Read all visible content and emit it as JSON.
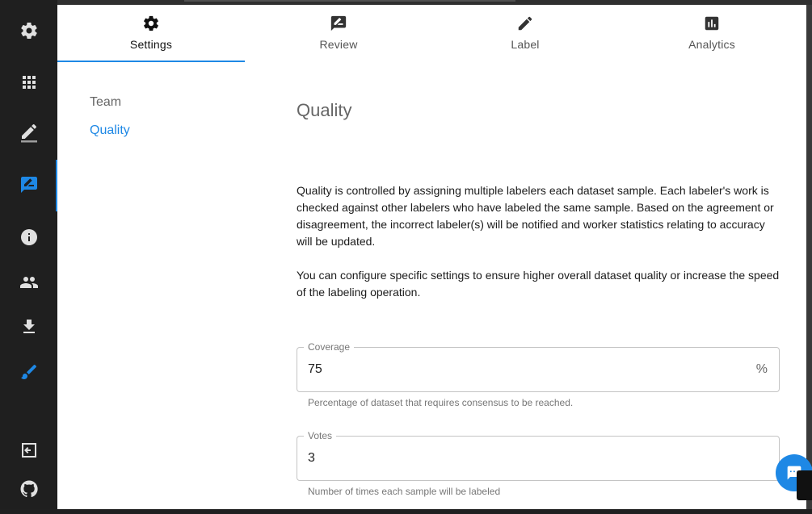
{
  "tabs": [
    {
      "label": "Settings",
      "icon": "gear-icon"
    },
    {
      "label": "Review",
      "icon": "rate-review-icon"
    },
    {
      "label": "Label",
      "icon": "pencil-icon"
    },
    {
      "label": "Analytics",
      "icon": "bar-chart-icon"
    }
  ],
  "sidebar": {
    "icons": [
      "gear-icon",
      "apps-grid-icon",
      "edit-icon",
      "rate-review-icon",
      "info-icon",
      "people-icon",
      "download-icon",
      "brush-icon",
      "exit-icon",
      "github-icon"
    ]
  },
  "subnav": {
    "items": [
      {
        "label": "Team"
      },
      {
        "label": "Quality"
      }
    ]
  },
  "content": {
    "title": "Quality",
    "paragraph1": "Quality is controlled by assigning multiple labelers each dataset sample. Each labeler's work is checked against other labelers who have labeled the same sample. Based on the agreement or disagreement, the incorrect labeler(s) will be notified and worker statistics relating to accuracy will be updated.",
    "paragraph2": "You can configure specific settings to ensure higher overall dataset quality or increase the speed of the labeling operation."
  },
  "coverage": {
    "label": "Coverage",
    "value": "75",
    "suffix": "%",
    "helper": "Percentage of dataset that requires consensus to be reached."
  },
  "votes": {
    "label": "Votes",
    "value": "3",
    "helper": "Number of times each sample will be labeled"
  },
  "colors": {
    "accent": "#1e88e5",
    "sidebar_bg": "#1f1f1f",
    "sidebar_icon": "#e0e0e0"
  }
}
